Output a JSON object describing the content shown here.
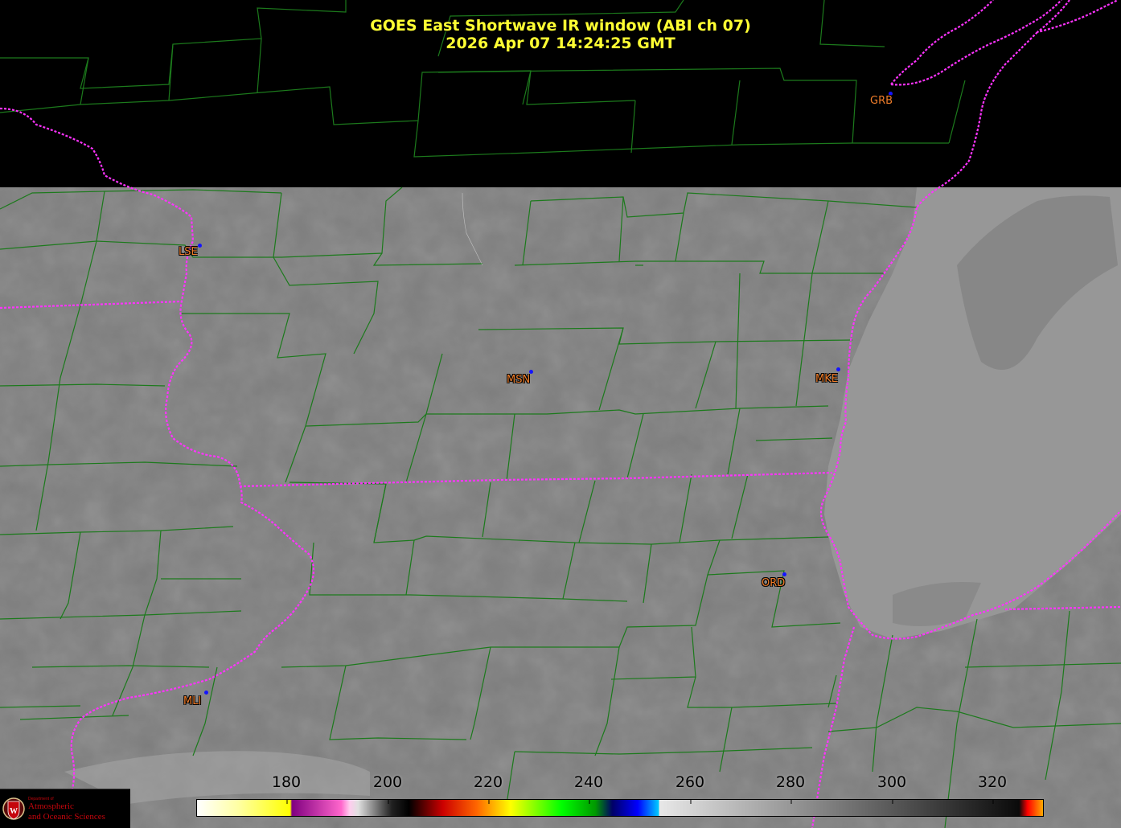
{
  "title": {
    "line1": "GOES East Shortwave IR window (ABI ch 07)",
    "line2": "2026 Apr 07  14:24:25 GMT"
  },
  "colors": {
    "title": "#ffff33",
    "county_lines": "#1c7a1c",
    "state_lines": "#ff33ff",
    "station_label": "#f07d2a",
    "station_dot": "#1414ff"
  },
  "stations": [
    {
      "id": "GRB",
      "label": "GRB"
    },
    {
      "id": "LSE",
      "label": "LSE"
    },
    {
      "id": "MSN",
      "label": "MSN"
    },
    {
      "id": "MKE",
      "label": "MKE"
    },
    {
      "id": "ORD",
      "label": "ORD"
    },
    {
      "id": "MLI",
      "label": "MLI"
    }
  ],
  "colorbar": {
    "ticks": [
      "180",
      "200",
      "220",
      "240",
      "260",
      "280",
      "300",
      "320"
    ]
  },
  "logo": {
    "dept": "Department of",
    "line1": "Atmospheric",
    "line2": "and Oceanic Sciences"
  }
}
